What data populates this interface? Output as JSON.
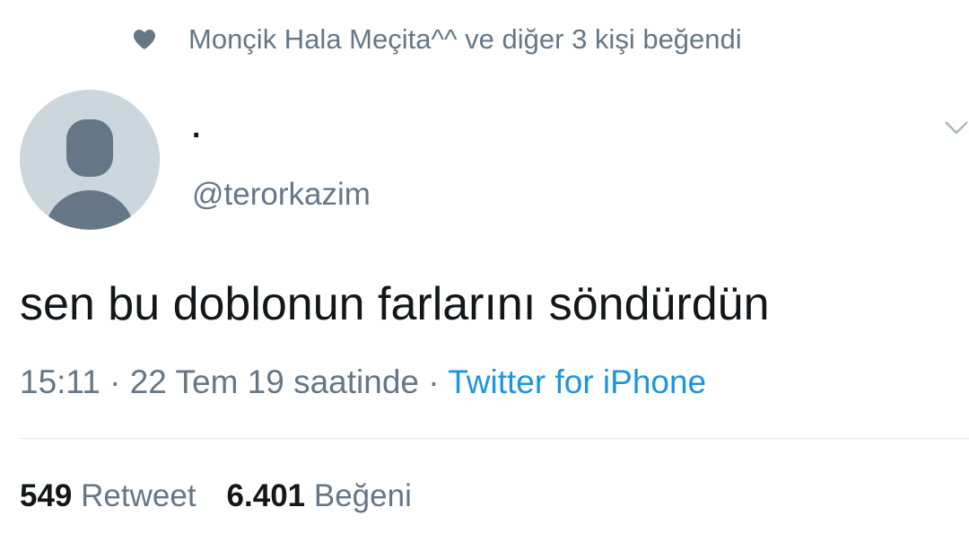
{
  "social_context": {
    "icon": "heart-icon",
    "text": "Monçik Hala Meçita^^ ve diğer 3 kişi beğendi"
  },
  "user": {
    "display_name": ".",
    "handle": "@terorkazim",
    "avatar": "default-avatar"
  },
  "tweet": {
    "text": "sen bu doblonun farlarını söndürdün",
    "time": "15:11 · 22 Tem 19 saatinde · ",
    "source": "Twitter for iPhone"
  },
  "stats": {
    "retweet_count": "549",
    "retweet_label": "Retweet",
    "like_count": "6.401",
    "like_label": "Beğeni"
  },
  "colors": {
    "secondary_text": "#657786",
    "link": "#1b95e0",
    "avatar_bg": "#ccd6dd",
    "avatar_fg": "#657786"
  }
}
